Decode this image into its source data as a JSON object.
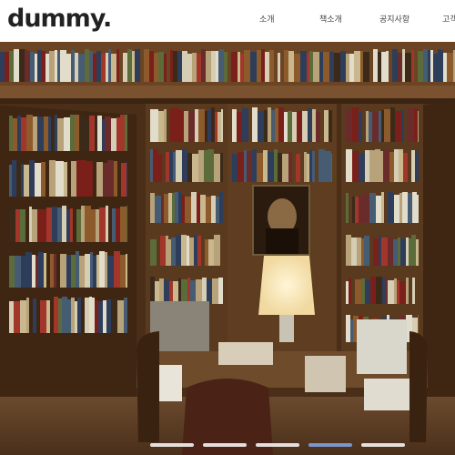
{
  "header": {
    "logo": "dummy.",
    "nav": [
      "소개",
      "책소개",
      "공지사항",
      "고객"
    ]
  },
  "hero": {
    "image": "library-bookshelves-photo",
    "slides": 5,
    "active_slide": 4
  },
  "colors": {
    "logo": "#222222",
    "dot_active": "#7b96c9",
    "dot_inactive": "#ffffff"
  }
}
